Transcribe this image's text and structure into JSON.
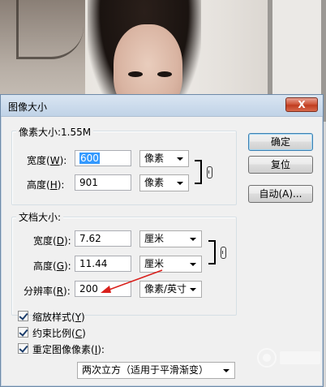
{
  "dialog": {
    "title": "图像大小",
    "close_label": "X"
  },
  "pixel_dimensions": {
    "legend": "像素大小:1.55M",
    "width": {
      "label_prefix": "宽度(",
      "mnemonic": "W",
      "label_suffix": "):",
      "value": "600",
      "unit": "像素"
    },
    "height": {
      "label_prefix": "高度(",
      "mnemonic": "H",
      "label_suffix": "):",
      "value": "901",
      "unit": "像素"
    }
  },
  "document_size": {
    "legend": "文档大小:",
    "width": {
      "label_prefix": "宽度(",
      "mnemonic": "D",
      "label_suffix": "):",
      "value": "7.62",
      "unit": "厘米"
    },
    "height": {
      "label_prefix": "高度(",
      "mnemonic": "G",
      "label_suffix": "):",
      "value": "11.44",
      "unit": "厘米"
    },
    "resolution": {
      "label_prefix": "分辨率(",
      "mnemonic": "R",
      "label_suffix": "):",
      "value": "200",
      "unit": "像素/英寸"
    }
  },
  "buttons": {
    "ok": "确定",
    "reset": "复位",
    "auto": "自动(A)..."
  },
  "options": {
    "scale_styles": {
      "label_prefix": "缩放样式(",
      "mnemonic": "Y",
      "label_suffix": ")",
      "checked": true
    },
    "constrain_proportions": {
      "label_prefix": "约束比例(",
      "mnemonic": "C",
      "label_suffix": ")",
      "checked": true
    },
    "resample": {
      "label_prefix": "重定图像像素(",
      "mnemonic": "I",
      "label_suffix": "):",
      "checked": true
    },
    "resample_method": "两次立方（适用于平滑渐变）"
  },
  "annotation": {
    "arrow_color": "#d9201c"
  }
}
